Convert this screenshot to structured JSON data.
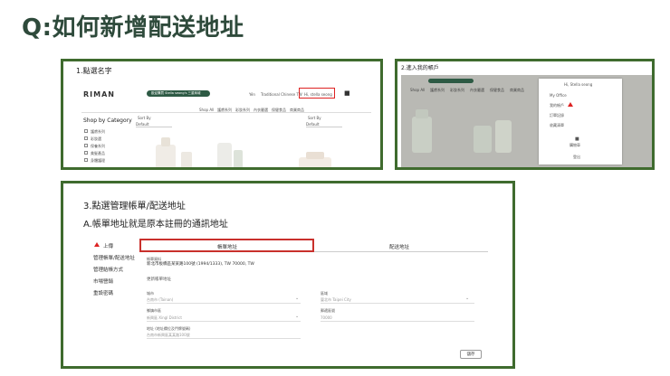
{
  "title": "Q:如何新增配送地址",
  "panel1": {
    "step": "1.點選名字",
    "logo": "RIMAN",
    "banner": "歡迎購買 Stella seong's 三重商城",
    "top_links": [
      "Yén",
      "Traditional Chinese TW",
      "Hi, stella seong"
    ],
    "nav": [
      "Shop All",
      "護膚系列",
      "彩妝系列",
      "內衣嚴選",
      "保健食品",
      "商業商品"
    ],
    "shop_by_category": "Shop by Category",
    "categories": [
      "護膚系列",
      "彩妝選",
      "保養系列",
      "美髮產品",
      "身體護理"
    ],
    "sort_label": "Sort By",
    "sort_value": "Default"
  },
  "panel2": {
    "step": "2.進入我的帳戶",
    "nav": [
      "Shop All",
      "護膚系列",
      "彩妝系列",
      "內衣嚴選",
      "保健食品",
      "商業商品"
    ],
    "menu_header": "Hi, Stella seong",
    "menu_items": [
      "My Office",
      "我的帳戶",
      "訂單記錄",
      "收藏清單",
      "購物車",
      "登出"
    ]
  },
  "panel3": {
    "step": "3.點選管理帳單/配送地址",
    "note": "A.帳單地址就是原本註冊的通訊地址",
    "sidebar": [
      "上傳",
      "管理帳單/配送地址",
      "管理結帳方式",
      "市場營銷",
      "重設密碼"
    ],
    "tabs": [
      "帳單地址",
      "配送地址"
    ],
    "billing_label": "帳單資料",
    "billing_address": "新北市板橋區某某路100號 (1994/1333), TW 70000, TW",
    "new_address_label": "更新帳單地址",
    "fields": [
      {
        "label": "城市",
        "value": "台南市 (Tainan)"
      },
      {
        "label": "區域",
        "value": "臺北市 Taipei City"
      },
      {
        "label": "鄉鎮市區",
        "value": "新興區 Xingl District"
      },
      {
        "label": "郵遞區號",
        "value": "70000"
      },
      {
        "label": "地址 (地址欄位及門牌號碼)",
        "value": "台南市新興區某某路100號"
      }
    ],
    "save_button": "儲存"
  },
  "colors": {
    "title": "#2e4a3b",
    "frame": "#3f6b2e",
    "highlight": "#d22222",
    "brand": "#2d5a44"
  }
}
